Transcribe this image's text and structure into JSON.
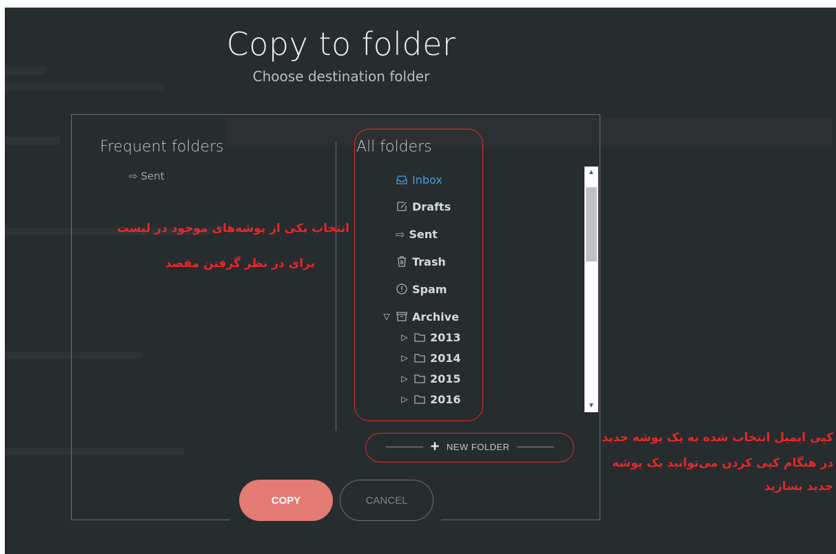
{
  "dialog": {
    "title": "Copy to folder",
    "subtitle": "Choose destination folder"
  },
  "frequent": {
    "title": "Frequent folders",
    "items": [
      {
        "label": "Sent",
        "icon": "sent-arrow-icon"
      }
    ]
  },
  "all_folders": {
    "title": "All folders",
    "items": [
      {
        "label": "Inbox",
        "icon": "inbox-icon",
        "active": true
      },
      {
        "label": "Drafts",
        "icon": "drafts-icon"
      },
      {
        "label": "Sent",
        "icon": "sent-arrow-icon"
      },
      {
        "label": "Trash",
        "icon": "trash-icon"
      },
      {
        "label": "Spam",
        "icon": "spam-icon"
      },
      {
        "label": "Archive",
        "icon": "archive-icon",
        "expanded": true
      },
      {
        "label": "2013",
        "icon": "folder-icon",
        "collapsed": true
      },
      {
        "label": "2014",
        "icon": "folder-icon",
        "collapsed": true
      },
      {
        "label": "2015",
        "icon": "folder-icon",
        "collapsed": true
      },
      {
        "label": "2016",
        "icon": "folder-icon",
        "collapsed": true
      }
    ]
  },
  "actions": {
    "new_folder": "NEW FOLDER",
    "copy": "COPY",
    "cancel": "CANCEL"
  },
  "annotations": {
    "left_line1": "انتخاب یکی از پوشه‌های موجود در لیست",
    "left_line2": "برای در نظر گرفتن مقصد",
    "right_line1": "کپی ایمیل انتخاب شده به یک پوشه جدید",
    "right_line2": "در هنگام کپی کردن می‌توانید یک پوشه",
    "right_line3": "جدید بسازید"
  },
  "colors": {
    "background": "#272c2f",
    "accent_active": "#4a9fd4",
    "copy_button": "#e47b74",
    "annotation": "#e82828"
  }
}
